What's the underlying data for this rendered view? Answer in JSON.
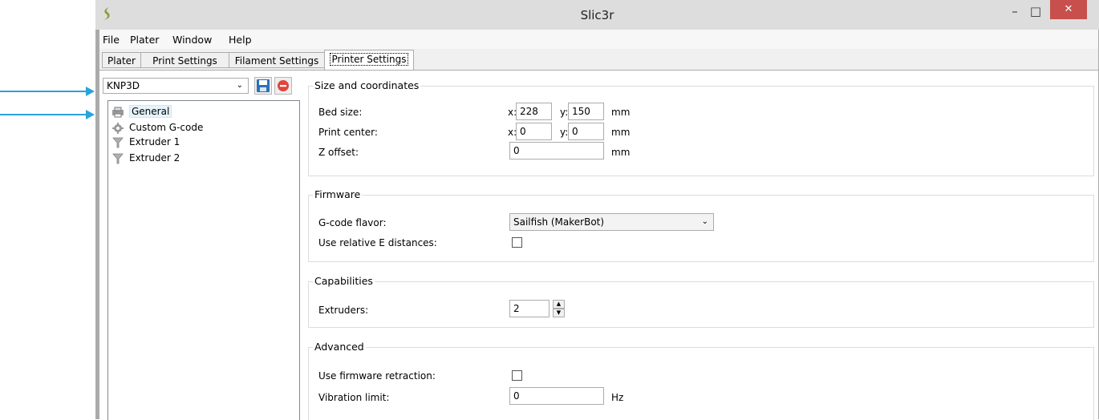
{
  "window": {
    "title": "Slic3r",
    "close": "✕",
    "minimize": "–",
    "maximize": "□"
  },
  "menu": [
    "File",
    "Plater",
    "Window",
    "Help"
  ],
  "tabs": [
    "Plater",
    "Print Settings",
    "Filament Settings",
    "Printer Settings"
  ],
  "active_tab": "Printer Settings",
  "preset": {
    "value": "KNP3D"
  },
  "tree": [
    "General",
    "Custom G-code",
    "Extruder 1",
    "Extruder 2"
  ],
  "sections": {
    "size": {
      "title": "Size and coordinates",
      "bed_size_label": "Bed size:",
      "bed_x": "228",
      "bed_y": "150",
      "print_center_label": "Print center:",
      "center_x": "0",
      "center_y": "0",
      "z_offset_label": "Z offset:",
      "z_offset": "0",
      "x_prefix": "x:",
      "y_prefix": "y:",
      "unit_mm": "mm"
    },
    "firmware": {
      "title": "Firmware",
      "flavor_label": "G-code flavor:",
      "flavor_value": "Sailfish (MakerBot)",
      "relative_e_label": "Use relative E distances:"
    },
    "capabilities": {
      "title": "Capabilities",
      "extruders_label": "Extruders:",
      "extruders_value": "2"
    },
    "advanced": {
      "title": "Advanced",
      "fw_retraction_label": "Use firmware retraction:",
      "vibration_label": "Vibration limit:",
      "vibration_value": "0",
      "unit_hz": "Hz"
    }
  },
  "colors": {
    "arrow": "#29a3dc",
    "close": "#c7504c",
    "selection": "#e5f3fb"
  }
}
